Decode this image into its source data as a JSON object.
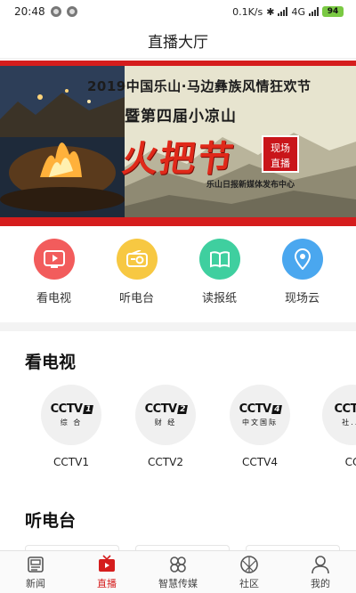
{
  "status_bar": {
    "time": "20:48",
    "network_speed": "0.1K/s",
    "network_type": "4G",
    "battery": "94"
  },
  "header": {
    "title": "直播大厅"
  },
  "banner": {
    "line1": "2019中国乐山·马边彝族风情狂欢节",
    "line2": "暨第四届小凉山",
    "torch_title": "火把节",
    "badge_line1": "现场",
    "badge_line2": "直播",
    "credit": "乐山日报新媒体发布中心"
  },
  "quick_nav": [
    {
      "label": "看电视",
      "icon": "play-icon",
      "color": "#f25c5c"
    },
    {
      "label": "听电台",
      "icon": "radio-icon",
      "color": "#f7c842"
    },
    {
      "label": "读报纸",
      "icon": "book-icon",
      "color": "#3fcf9f"
    },
    {
      "label": "现场云",
      "icon": "location-pin-icon",
      "color": "#4aa7ef"
    }
  ],
  "tv_section": {
    "title": "看电视",
    "channels": [
      {
        "logo_text": "CCTV",
        "logo_num": "1",
        "logo_sub": "综 合",
        "label": "CCTV1"
      },
      {
        "logo_text": "CCTV",
        "logo_num": "2",
        "logo_sub": "财 经",
        "label": "CCTV2"
      },
      {
        "logo_text": "CCTV",
        "logo_num": "4",
        "logo_sub": "中文国际",
        "label": "CCTV4"
      },
      {
        "logo_text": "CCTV",
        "logo_num": "",
        "logo_sub": "社...",
        "label": "CC"
      }
    ]
  },
  "radio_section": {
    "title": "听电台"
  },
  "bottom_nav": [
    {
      "label": "新闻",
      "icon": "news-icon",
      "active": false
    },
    {
      "label": "直播",
      "icon": "live-tv-icon",
      "active": true
    },
    {
      "label": "智慧传媒",
      "icon": "smart-media-icon",
      "active": false
    },
    {
      "label": "社区",
      "icon": "community-icon",
      "active": false
    },
    {
      "label": "我的",
      "icon": "profile-icon",
      "active": false
    }
  ],
  "colors": {
    "accent": "#d51d1d"
  }
}
